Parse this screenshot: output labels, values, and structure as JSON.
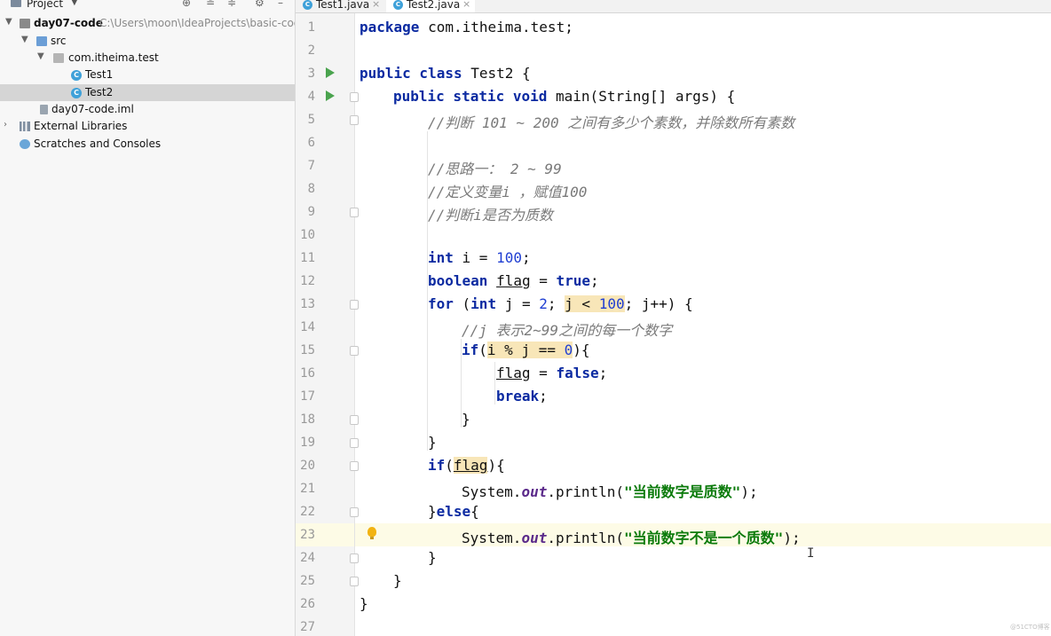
{
  "project_pane": {
    "header_label": "Project",
    "tree": [
      {
        "label": "day07-code",
        "path": "C:\\Users\\moon\\IdeaProjects\\basic-code"
      },
      {
        "label": "src"
      },
      {
        "label": "com.itheima.test"
      },
      {
        "label": "Test1"
      },
      {
        "label": "Test2"
      },
      {
        "label": "day07-code.iml"
      },
      {
        "label": "External Libraries"
      },
      {
        "label": "Scratches and Consoles"
      }
    ]
  },
  "editor": {
    "tabs": [
      {
        "label": "Test1.java"
      },
      {
        "label": "Test2.java"
      }
    ],
    "current_line": 23,
    "lines": [
      {
        "n": "1"
      },
      {
        "n": "2"
      },
      {
        "n": "3"
      },
      {
        "n": "4"
      },
      {
        "n": "5"
      },
      {
        "n": "6"
      },
      {
        "n": "7"
      },
      {
        "n": "8"
      },
      {
        "n": "9"
      },
      {
        "n": "10"
      },
      {
        "n": "11"
      },
      {
        "n": "12"
      },
      {
        "n": "13"
      },
      {
        "n": "14"
      },
      {
        "n": "15"
      },
      {
        "n": "16"
      },
      {
        "n": "17"
      },
      {
        "n": "18"
      },
      {
        "n": "19"
      },
      {
        "n": "20"
      },
      {
        "n": "21"
      },
      {
        "n": "22"
      },
      {
        "n": "23"
      },
      {
        "n": "24"
      },
      {
        "n": "25"
      },
      {
        "n": "26"
      },
      {
        "n": "27"
      }
    ],
    "code": {
      "l1_kw": "package",
      "l1_rest": " com.itheima.test;",
      "l3_kw": "public class",
      "l3_rest": " Test2 {",
      "l4_kw": "public static void",
      "l4_rest": " main(String[] args) {",
      "l5_cmt": "//判断 101 ~ 200 之间有多少个素数，并除数所有素数",
      "l7_cmt": "//思路一： 2 ~ 99",
      "l8_cmt": "//定义变量i ，赋值100",
      "l9_cmt": "//判断i是否为质数",
      "l11_kw": "int",
      "l11_mid": " i = ",
      "l11_num": "100",
      "l11_end": ";",
      "l12_kw": "boolean",
      "l12_var": "flag",
      "l12_mid": " = ",
      "l12_kw2": "true",
      "l12_end": ";",
      "l13_kw": "for",
      "l13_a": " (",
      "l13_kw2": "int",
      "l13_b": " j = ",
      "l13_num": "2",
      "l13_c": "; ",
      "l13_hl": "j < ",
      "l13_num2": "100",
      "l13_d": "; j++) {",
      "l14_cmt": "//j 表示2~99之间的每一个数字",
      "l15_kw": "if",
      "l15_a": "(",
      "l15_hl": "i % j == ",
      "l15_num": "0",
      "l15_b": "){",
      "l16_var": "flag",
      "l16_mid": " = ",
      "l16_kw": "false",
      "l16_end": ";",
      "l17_kw": "break",
      "l17_end": ";",
      "l18": "}",
      "l19": "}",
      "l20_kw": "if",
      "l20_a": "(",
      "l20_var": "flag",
      "l20_b": "){",
      "l21_a": "System.",
      "l21_field": "out",
      "l21_b": ".println(",
      "l21_str": "\"当前数字是质数\"",
      "l21_c": ");",
      "l22_a": "}",
      "l22_kw": "else",
      "l22_b": "{",
      "l23_a": "System.",
      "l23_field": "out",
      "l23_b": ".println(",
      "l23_str": "\"当前数字不是一个质数\"",
      "l23_c": ");",
      "l24": "}",
      "l25": "}",
      "l26": "}"
    },
    "text_cursor": "I"
  },
  "watermark": "@51CTO博客",
  "colors": {
    "keyword": "#0b2aa1",
    "number": "#1f3ed2",
    "string": "#0a7a0a",
    "comment": "#7a7a7a",
    "current_line": "#fdfbe6",
    "run_icon": "#4aa34e"
  }
}
